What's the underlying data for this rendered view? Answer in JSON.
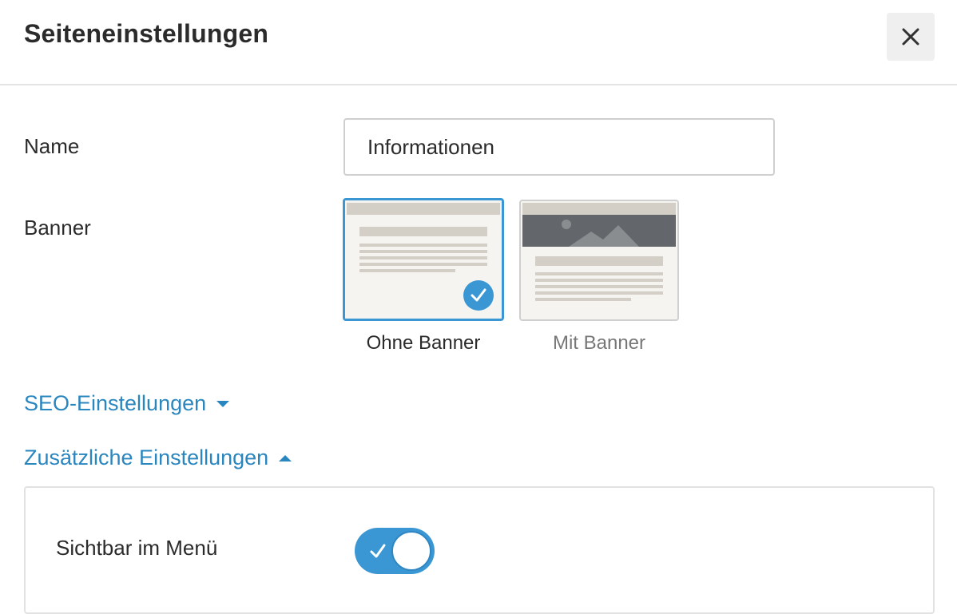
{
  "dialog": {
    "title": "Seiteneinstellungen",
    "close_icon": "close-icon"
  },
  "form": {
    "name_label": "Name",
    "name_value": "Informationen",
    "banner_label": "Banner",
    "banner_options": [
      {
        "label": "Ohne Banner",
        "selected": true
      },
      {
        "label": "Mit Banner",
        "selected": false
      }
    ]
  },
  "sections": {
    "seo": {
      "label": "SEO-Einstellungen",
      "expanded": false,
      "icon": "caret-down-icon"
    },
    "extra": {
      "label": "Zusätzliche Einstellungen",
      "expanded": true,
      "icon": "caret-up-icon"
    }
  },
  "extra_panel": {
    "visible_in_menu_label": "Sichtbar im Menü",
    "visible_in_menu_on": true
  },
  "colors": {
    "accent": "#3a97d4",
    "link": "#2a86bf",
    "thumb_bg": "#f5f4f0",
    "thumb_bar": "#d3cfc6",
    "banner_dark": "#63676b"
  }
}
